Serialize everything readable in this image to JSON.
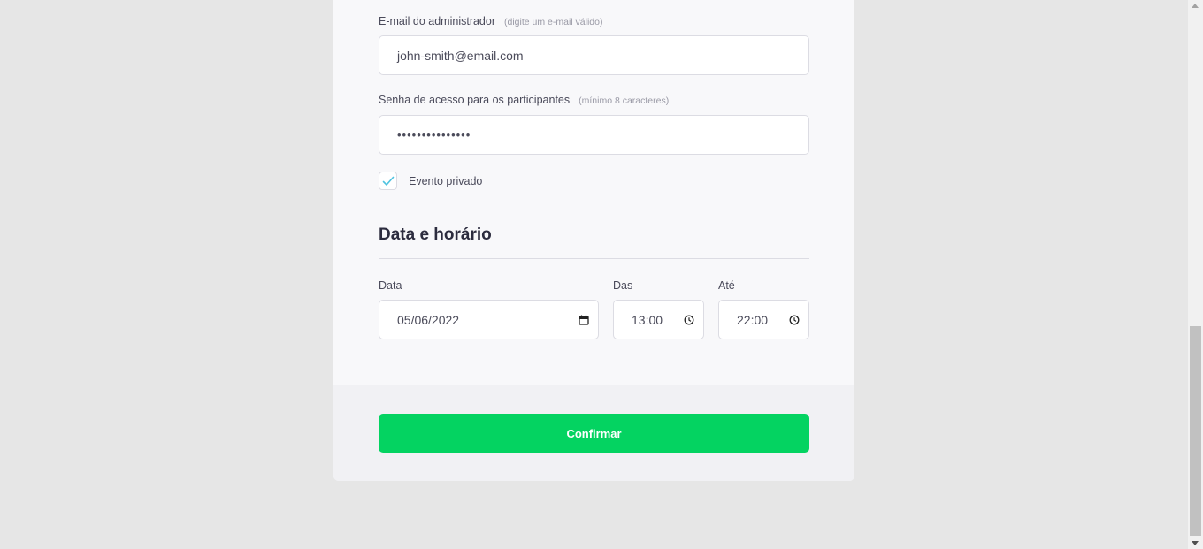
{
  "form": {
    "email": {
      "label": "E-mail do administrador",
      "hint": "(digite um e-mail válido)",
      "value": "john-smith@email.com"
    },
    "password": {
      "label": "Senha de acesso para os participantes",
      "hint": "(mínimo 8 caracteres)",
      "value": "•••••••••••••••"
    },
    "private_event": {
      "label": "Evento privado",
      "checked": true
    }
  },
  "schedule": {
    "title": "Data e horário",
    "date": {
      "label": "Data",
      "value": "05/06/2022",
      "icon": "calendar-icon"
    },
    "from": {
      "label": "Das",
      "value": "13:00",
      "icon": "clock-icon"
    },
    "to": {
      "label": "Até",
      "value": "22:00",
      "icon": "clock-icon"
    }
  },
  "footer": {
    "confirm_label": "Confirmar"
  },
  "colors": {
    "accent": "#04d361",
    "check": "#4fc3e0"
  }
}
